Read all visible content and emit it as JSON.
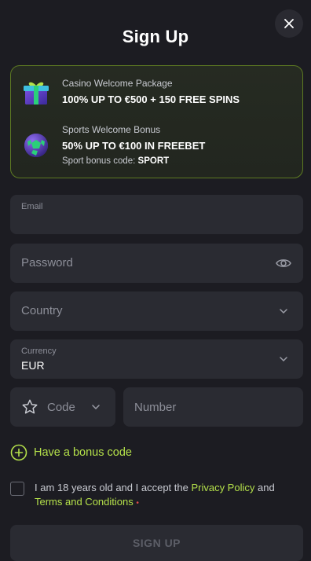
{
  "title": "Sign Up",
  "bonus": {
    "casino": {
      "label": "Casino Welcome Package",
      "offer": "100% UP TO €500 + 150 FREE SPINS"
    },
    "sports": {
      "label": "Sports Welcome Bonus",
      "offer": "50% UP TO €100 IN FREEBET",
      "code_label": "Sport bonus code:",
      "code_value": "SPORT"
    }
  },
  "form": {
    "email_label": "Email",
    "password_placeholder": "Password",
    "country_placeholder": "Country",
    "currency_label": "Currency",
    "currency_value": "EUR",
    "code_placeholder": "Code",
    "number_placeholder": "Number"
  },
  "bonus_code_link": "Have a bonus code",
  "terms": {
    "prefix": "I am 18 years old and I accept the ",
    "privacy": "Privacy Policy",
    "and": " and ",
    "terms_link": "Terms and Conditions",
    "required_mark": "•"
  },
  "submit_label": "SIGN UP",
  "colors": {
    "accent": "#b4e04a",
    "background": "#1c1c22",
    "field": "#2a2b32"
  },
  "icons": [
    "close-icon",
    "gift-icon",
    "soccer-ball-icon",
    "eye-icon",
    "chevron-down-icon",
    "star-icon",
    "plus-circle-icon"
  ]
}
